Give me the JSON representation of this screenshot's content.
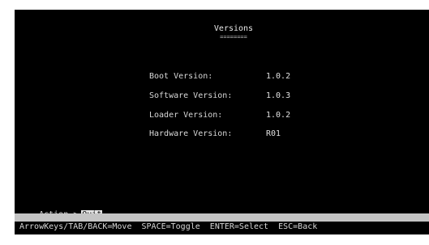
{
  "screen": {
    "title": "Versions",
    "title_underline": "========",
    "info": [
      {
        "label": "Boot Version:",
        "value": "1.0.2"
      },
      {
        "label": "Software Version:",
        "value": "1.0.3"
      },
      {
        "label": "Loader Version:",
        "value": "1.0.2"
      },
      {
        "label": "Hardware Version:",
        "value": "R01"
      }
    ],
    "action": {
      "prompt": "Action->",
      "selected": "Quit"
    },
    "help": "ArrowKeys/TAB/BACK=Move  SPACE=Toggle  ENTER=Select  ESC=Back"
  },
  "colors": {
    "background": "#000000",
    "text": "#d8d8d8",
    "highlight": "#e6e6e6",
    "status_bar": "#c4c4c4",
    "page": "#ffffff"
  }
}
